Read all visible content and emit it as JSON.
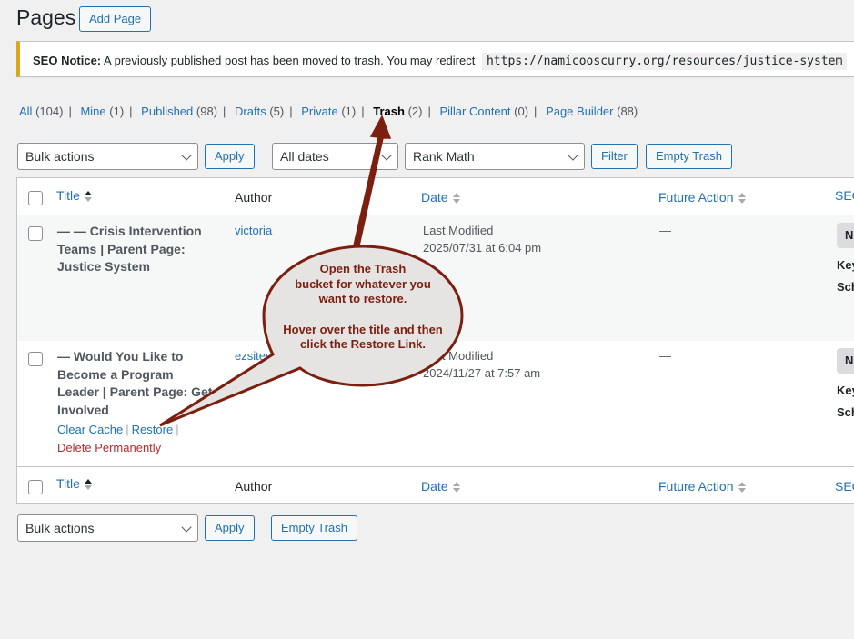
{
  "header": {
    "title": "Pages",
    "add_button": "Add Page"
  },
  "notice": {
    "label": "SEO Notice:",
    "message": "A previously published post has been moved to trash. You may redirect",
    "url": "https://namicooscurry.org/resources/justice-system"
  },
  "filters": [
    {
      "label": "All",
      "count": "(104)"
    },
    {
      "label": "Mine",
      "count": "(1)"
    },
    {
      "label": "Published",
      "count": "(98)"
    },
    {
      "label": "Drafts",
      "count": "(5)"
    },
    {
      "label": "Private",
      "count": "(1)"
    },
    {
      "label": "Trash",
      "count": "(2)"
    },
    {
      "label": "Pillar Content",
      "count": "(0)"
    },
    {
      "label": "Page Builder",
      "count": "(88)"
    }
  ],
  "toolbar": {
    "bulk_actions": "Bulk actions",
    "apply": "Apply",
    "dates": "All dates",
    "seo_filter": "Rank Math",
    "filter": "Filter",
    "empty_trash": "Empty Trash"
  },
  "columns": {
    "title": "Title",
    "author": "Author",
    "date": "Date",
    "future_action": "Future Action",
    "seo": "SEO"
  },
  "rows": [
    {
      "title_lines": [
        "— — Crisis Intervention",
        "Teams | Parent Page:",
        "Justice System"
      ],
      "author": "victoria",
      "date_status": "Last Modified",
      "date_value": "2025/07/31 at 6:04 pm",
      "future_action": "—",
      "seo_badge": "N",
      "seo_line1": "Key",
      "seo_line2": "Sch"
    },
    {
      "title_lines": [
        "— Would You Like to",
        "Become a Program",
        "Leader | Parent Page: Get",
        "Involved"
      ],
      "author": "ezsitesonline",
      "date_status": "Last Modified",
      "date_value": "2024/11/27 at 7:57 am",
      "future_action": "—",
      "seo_badge": "N",
      "seo_line1": "Key",
      "seo_line2": "Sch",
      "actions": {
        "clear_cache": "Clear Cache",
        "restore": "Restore",
        "delete": "Delete Permanently"
      }
    }
  ],
  "callout": {
    "line1": "Open the Trash",
    "line2": "bucket for whatever you",
    "line3": "want to restore.",
    "line4": "Hover over the title and then",
    "line5": "click the Restore Link.",
    "color": "#7b1f10",
    "fill": "#e6e4e2"
  },
  "bottom_toolbar": {
    "bulk_actions": "Bulk actions",
    "apply": "Apply",
    "empty_trash": "Empty Trash"
  }
}
